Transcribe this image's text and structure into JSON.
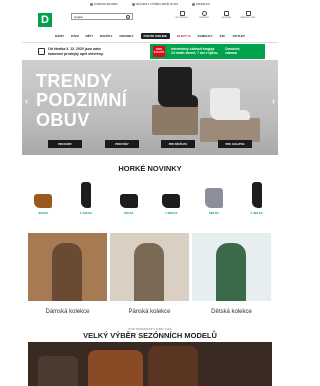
{
  "topbar": {
    "items": [
      {
        "icon": "truck-icon",
        "label": "DOPRAVA ZDARMA"
      },
      {
        "icon": "return-icon",
        "label": "VRÁCENÍ A VÝMĚNA ZBOŽÍ 30 DNÍ"
      },
      {
        "icon": "store-icon",
        "label": "PRODEJNY"
      }
    ]
  },
  "header": {
    "logo": "D",
    "search": {
      "value": "angleš"
    },
    "icons": [
      {
        "name": "store-locator-icon",
        "label": "MŮJ OBCHOD"
      },
      {
        "name": "user-icon",
        "label": "PŘIHLÁSIT"
      },
      {
        "name": "heart-icon",
        "label": "OBLÍBENÉ"
      },
      {
        "name": "cart-icon",
        "label": "NÁKUPNÍ KOŠÍK"
      }
    ]
  },
  "nav": {
    "items": [
      {
        "label": "DÁMY",
        "style": "normal"
      },
      {
        "label": "PÁNI",
        "style": "normal"
      },
      {
        "label": "DĚTI",
        "style": "normal"
      },
      {
        "label": "ZNAČKY",
        "style": "normal"
      },
      {
        "label": "NOVINKY",
        "style": "normal"
      },
      {
        "label": "POUZE ONLINE",
        "style": "dark"
      },
      {
        "label": "SLEVY %",
        "style": "red"
      },
      {
        "label": "KABELKY",
        "style": "normal"
      },
      {
        "label": "XXL",
        "style": "normal"
      },
      {
        "label": "OUTLET",
        "style": "normal"
      }
    ]
  },
  "promo": {
    "left_line1": "Od čtvrtka 3. 12. 2020 jsou naše",
    "left_line2": "kamenné prodejny opět otevřeny.",
    "badge": "100% KVALITA",
    "right_line1": "Internetový obchod funguje",
    "right_line2": "24 hodin denně, 7 dní v týdnu.",
    "right2_line1": "Doručení",
    "right2_line2": "zdarma"
  },
  "hero": {
    "title_line1": "TRENDY",
    "title_line2": "PODZIMNÍ",
    "title_line3": "OBUV",
    "ctas": [
      "PRO DÁMY",
      "PRO PÁNY",
      "PRO DĚVČATA",
      "PRO CHLAPCE"
    ]
  },
  "novinky": {
    "title": "HORKÉ NOVINKY",
    "products": [
      {
        "price": "999 Kč",
        "color": "#9a5a1f",
        "type": "low"
      },
      {
        "price": "1 199 Kč",
        "color": "#1d1d1d",
        "type": "tall"
      },
      {
        "price": "799 Kč",
        "color": "#1d1d1d",
        "type": "low"
      },
      {
        "price": "1 299 Kč",
        "color": "#1d1d1d",
        "type": "low"
      },
      {
        "price": "699 Kč",
        "color": "#8a8f99",
        "type": "mid"
      },
      {
        "price": "1 499 Kč",
        "color": "#1d1d1d",
        "type": "tall"
      }
    ]
  },
  "collections": [
    {
      "label": "Dámská kolekce",
      "bg": "#a67a52"
    },
    {
      "label": "Pánská kolekce",
      "bg": "#d9cfc2"
    },
    {
      "label": "Dětská kolekce",
      "bg": "#e7eef0"
    }
  ],
  "season": {
    "subtitle": "TOP PRODUKTY PRO VÁS",
    "title": "VELKÝ VÝBĚR SEZÓNNÍCH MODELŮ"
  }
}
